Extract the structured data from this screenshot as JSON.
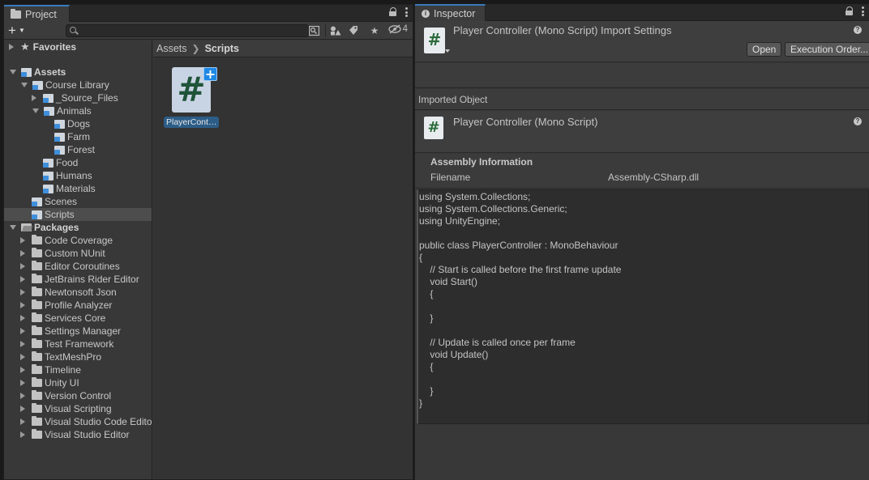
{
  "project": {
    "tab_label": "Project",
    "add_label": "+",
    "search": {
      "value": "",
      "placeholder": ""
    },
    "hidden_count": "4",
    "tree": [
      {
        "label": "Favorites",
        "depth": 0,
        "expander": "right",
        "icon": "star-icon",
        "bold": true
      },
      {
        "label": "Assets",
        "depth": 0,
        "expander": "down",
        "icon": "asset-folder-icon",
        "bold": true
      },
      {
        "label": "Course Library",
        "depth": 1,
        "expander": "down",
        "icon": "asset-folder-icon"
      },
      {
        "label": "_Source_Files",
        "depth": 2,
        "expander": "right",
        "icon": "asset-folder-icon"
      },
      {
        "label": "Animals",
        "depth": 2,
        "expander": "down",
        "icon": "asset-folder-icon"
      },
      {
        "label": "Dogs",
        "depth": 3,
        "expander": "none",
        "icon": "asset-folder-icon"
      },
      {
        "label": "Farm",
        "depth": 3,
        "expander": "none",
        "icon": "asset-folder-icon"
      },
      {
        "label": "Forest",
        "depth": 3,
        "expander": "none",
        "icon": "asset-folder-icon"
      },
      {
        "label": "Food",
        "depth": 2,
        "expander": "none",
        "icon": "asset-folder-icon"
      },
      {
        "label": "Humans",
        "depth": 2,
        "expander": "none",
        "icon": "asset-folder-icon"
      },
      {
        "label": "Materials",
        "depth": 2,
        "expander": "none",
        "icon": "asset-folder-icon"
      },
      {
        "label": "Scenes",
        "depth": 1,
        "expander": "none",
        "icon": "asset-folder-icon"
      },
      {
        "label": "Scripts",
        "depth": 1,
        "expander": "none",
        "icon": "asset-folder-icon",
        "selected": true
      },
      {
        "label": "Packages",
        "depth": 0,
        "expander": "down",
        "icon": "folder-open-icon",
        "bold": true
      },
      {
        "label": "Code Coverage",
        "depth": 1,
        "expander": "right",
        "icon": "folder-icon"
      },
      {
        "label": "Custom NUnit",
        "depth": 1,
        "expander": "right",
        "icon": "folder-icon"
      },
      {
        "label": "Editor Coroutines",
        "depth": 1,
        "expander": "right",
        "icon": "folder-icon"
      },
      {
        "label": "JetBrains Rider Editor",
        "depth": 1,
        "expander": "right",
        "icon": "folder-icon"
      },
      {
        "label": "Newtonsoft Json",
        "depth": 1,
        "expander": "right",
        "icon": "folder-icon"
      },
      {
        "label": "Profile Analyzer",
        "depth": 1,
        "expander": "right",
        "icon": "folder-icon"
      },
      {
        "label": "Services Core",
        "depth": 1,
        "expander": "right",
        "icon": "folder-icon"
      },
      {
        "label": "Settings Manager",
        "depth": 1,
        "expander": "right",
        "icon": "folder-icon"
      },
      {
        "label": "Test Framework",
        "depth": 1,
        "expander": "right",
        "icon": "folder-icon"
      },
      {
        "label": "TextMeshPro",
        "depth": 1,
        "expander": "right",
        "icon": "folder-icon"
      },
      {
        "label": "Timeline",
        "depth": 1,
        "expander": "right",
        "icon": "folder-icon"
      },
      {
        "label": "Unity UI",
        "depth": 1,
        "expander": "right",
        "icon": "folder-icon"
      },
      {
        "label": "Version Control",
        "depth": 1,
        "expander": "right",
        "icon": "folder-icon"
      },
      {
        "label": "Visual Scripting",
        "depth": 1,
        "expander": "right",
        "icon": "folder-icon"
      },
      {
        "label": "Visual Studio Code Editor",
        "depth": 1,
        "expander": "right",
        "icon": "folder-icon"
      },
      {
        "label": "Visual Studio Editor",
        "depth": 1,
        "expander": "right",
        "icon": "folder-icon"
      }
    ],
    "breadcrumb": [
      "Assets",
      "Scripts"
    ],
    "assets": [
      {
        "label": "PlayerCont…",
        "icon": "csharp-script-icon"
      }
    ]
  },
  "inspector": {
    "tab_label": "Inspector",
    "header_title": "Player Controller (Mono Script) Import Settings",
    "open_label": "Open",
    "execution_order_label": "Execution Order...",
    "imported_object_label": "Imported Object",
    "imported_title": "Player Controller (Mono Script)",
    "assembly_title": "Assembly Information",
    "filename_key": "Filename",
    "filename_value": "Assembly-CSharp.dll",
    "code_lines": [
      "using System.Collections;",
      "using System.Collections.Generic;",
      "using UnityEngine;",
      "",
      "public class PlayerController : MonoBehaviour",
      "{",
      "    // Start is called before the first frame update",
      "    void Start()",
      "    {",
      "",
      "    }",
      "",
      "    // Update is called once per frame",
      "    void Update()",
      "    {",
      "",
      "    }",
      "}"
    ]
  },
  "colors": {
    "accent_tab": "#3a79bb",
    "selection": "#2c5d87",
    "panel_bg": "#383838"
  }
}
